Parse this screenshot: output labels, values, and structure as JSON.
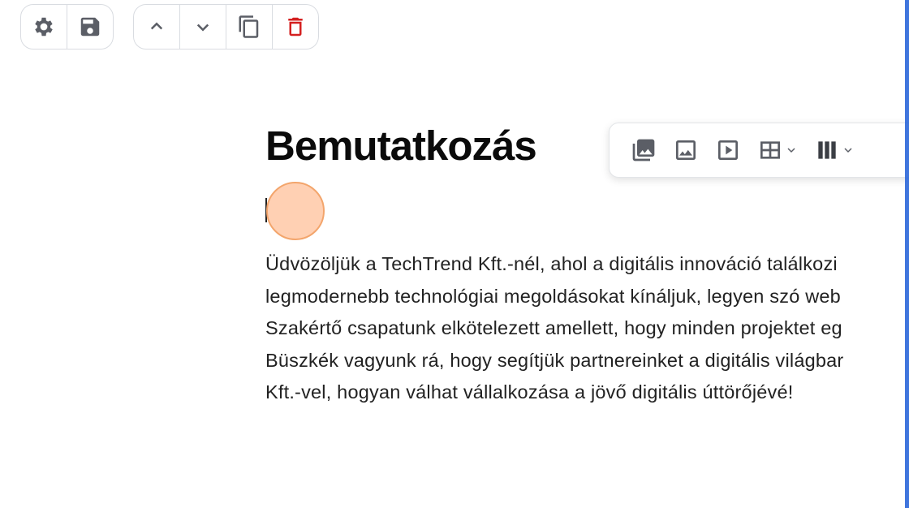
{
  "toolbar_left": {
    "settings_icon": "gear-icon",
    "save_icon": "save-icon"
  },
  "toolbar_right": {
    "move_up_icon": "chevron-up-icon",
    "move_down_icon": "chevron-down-icon",
    "duplicate_icon": "copy-icon",
    "delete_icon": "trash-icon",
    "delete_color": "#d42020"
  },
  "editor": {
    "title": "Bemutatkozás",
    "paragraph_lines": [
      "Üdvözöljük a TechTrend Kft.-nél, ahol a digitális innováció találkozi",
      "legmodernebb technológiai megoldásokat kínáljuk, legyen szó web",
      "Szakértő csapatunk elkötelezett amellett, hogy minden projektet eg",
      "Büszkék vagyunk rá, hogy segítjük partnereinket a digitális világbar",
      "Kft.-vel, hogyan válhat vállalkozása a jövő digitális úttörőjévé!"
    ]
  },
  "insert_toolbar": {
    "items": [
      "gallery-icon",
      "image-icon",
      "video-icon",
      "table-icon",
      "columns-icon"
    ]
  },
  "colors": {
    "icon_gray": "#5b5e66",
    "accent_blue": "#2b66d9",
    "cursor_fill": "#ffc4a0"
  }
}
